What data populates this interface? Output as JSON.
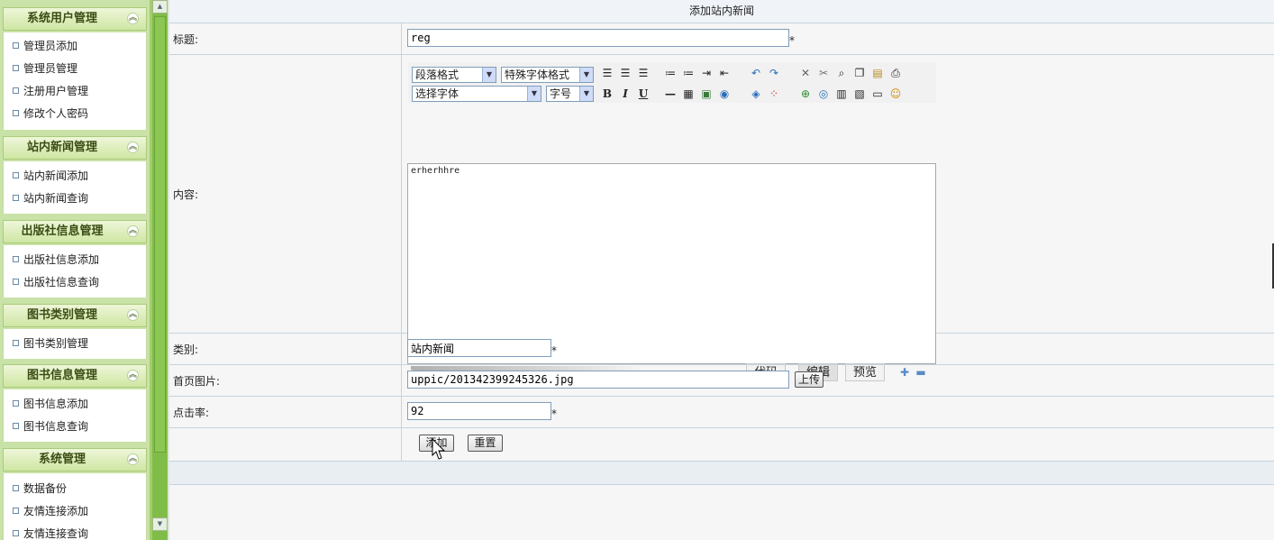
{
  "sidebar": {
    "sections": [
      {
        "title": "系统用户管理",
        "items": [
          "管理员添加",
          "管理员管理",
          "注册用户管理",
          "修改个人密码"
        ]
      },
      {
        "title": "站内新闻管理",
        "items": [
          "站内新闻添加",
          "站内新闻查询"
        ]
      },
      {
        "title": "出版社信息管理",
        "items": [
          "出版社信息添加",
          "出版社信息查询"
        ]
      },
      {
        "title": "图书类别管理",
        "items": [
          "图书类别管理"
        ]
      },
      {
        "title": "图书信息管理",
        "items": [
          "图书信息添加",
          "图书信息查询"
        ]
      },
      {
        "title": "系统管理",
        "items": [
          "数据备份",
          "友情连接添加",
          "友情连接查询"
        ]
      }
    ],
    "collapse_icon": "double-chevron-up-icon"
  },
  "form": {
    "heading": "添加站内新闻",
    "fields": {
      "title": {
        "label": "标题:",
        "value": "reg",
        "required_mark": "*"
      },
      "content": {
        "label": "内容:"
      },
      "category": {
        "label": "类别:",
        "value": "站内新闻",
        "required_mark": "*"
      },
      "image": {
        "label": "首页图片:",
        "value": "uppic/201342399245326.jpg",
        "upload_label": "上传"
      },
      "hits": {
        "label": "点击率:",
        "value": "92",
        "required_mark": "*"
      }
    },
    "buttons": {
      "submit": "添加",
      "reset": "重置"
    }
  },
  "editor": {
    "paragraph_format": "段落格式",
    "special_format": "特殊字体格式",
    "font": "选择字体",
    "font_size": "字号",
    "content": "erherhhre",
    "modes": [
      "代码",
      "编辑",
      "预览"
    ],
    "expand_symbol": "✚",
    "shrink_symbol": "▬"
  }
}
